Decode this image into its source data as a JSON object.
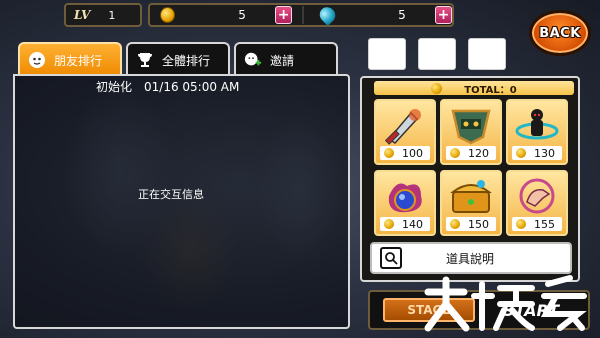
{
  "top_bar": {
    "level_tag": "LV",
    "level_value": "1",
    "coins": "5",
    "gems": "5",
    "plus": "+"
  },
  "back_button": {
    "label": "BACK"
  },
  "tabs": [
    {
      "label": "朋友排行",
      "icon": "person-icon",
      "active": true
    },
    {
      "label": "全體排行",
      "icon": "trophy-icon",
      "active": false
    },
    {
      "label": "邀請",
      "icon": "add-friend-icon",
      "active": false
    }
  ],
  "ranking_panel": {
    "init_text": "初始化　01/16 05:00 AM",
    "status_text": "正在交互信息"
  },
  "shop": {
    "total_label": "TOTAL：0",
    "items": [
      {
        "name": "sword",
        "price": "100",
        "color": "#b8292e"
      },
      {
        "name": "shield",
        "price": "120",
        "color": "#3d6b4f"
      },
      {
        "name": "ring",
        "price": "130",
        "color": "#22b7c7"
      },
      {
        "name": "orb",
        "price": "140",
        "color": "#2a4bd1"
      },
      {
        "name": "chest",
        "price": "150",
        "color": "#e0951a"
      },
      {
        "name": "gauntlet",
        "price": "155",
        "color": "#c64a8c"
      }
    ],
    "explain_label": "道具說明"
  },
  "bottom": {
    "stage_label": "STAGE",
    "start_label": "START",
    "watermark": "大狂客"
  },
  "colors": {
    "accent_orange": "#ee8a00",
    "gold": "#f5b546",
    "plus_pink": "#b0205a"
  }
}
